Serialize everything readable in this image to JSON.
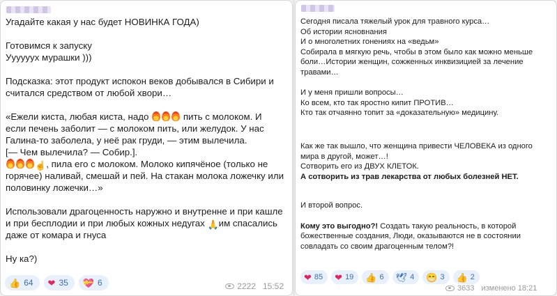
{
  "left": {
    "lines": {
      "l1": "Угадайте какая у нас будет НОВИНКА ГОДА)",
      "l2": "Готовимся к запуску",
      "l3": "Уууууух мурашки )))",
      "l4": "Подсказка: этот продукт испокон веков добывался в Сибири и",
      "l5": "считался средством от любой хвори…",
      "l6a": "«Ежели киста, любая киста, надо ",
      "l6b": " пить с молоком. И",
      "l7": "если печень заболит — с молоком пить, или желудок. У нас",
      "l8": "Галина-то заболела, у неё рак груди, — этим вылечила.",
      "l9": "[— Чем вылечила? — Собир.].",
      "l10": ", пила его с молоком. Молоко кипячёное (только не",
      "l11": "горячее) наливай, смешай и пей. На стакан молока ложечку или",
      "l12": "половинку ложечки…»",
      "l13": "Использовали драгоценность наружно и внутренне и при кашле",
      "l14a": "и при бесплодии и при любых кожных недугах ",
      "l14b": "им спасались",
      "l15": "даже от комара и гнуса",
      "l16": "Ну ка?)"
    },
    "reactions": [
      {
        "icon": "thumbs-up-icon",
        "glyph": "👍",
        "count": "64"
      },
      {
        "icon": "heart-icon",
        "glyph": "❤",
        "count": "35"
      },
      {
        "icon": "heart-hands-icon",
        "glyph": "💝",
        "count": "6"
      }
    ],
    "views": "2222",
    "time": "15:52"
  },
  "right": {
    "lines": {
      "r1": "Сегодня писала тяжелый урок для травного курса…",
      "r2": "Об истории ясновнания",
      "r3": "И о многолетних гонениях на «ведьм»",
      "r4": "Собирала в мягкую речь, чтобы в этом было как можно меньше",
      "r5": "боли…Истории женщин, сожженных инквизицией за лечение",
      "r6": "травами…",
      "r7": "И у меня пришли вопросы…",
      "r8": "Ко всем, кто так яростно кипит ПРОТИВ…",
      "r9": "Кто так отчаянно топит за «доказательную» медицину.",
      "r10": "Как же так вышло, что женщина привести ЧЕЛОВЕКА из одного",
      "r11": "мира в другой, может…!",
      "r12": "Сотворить его из ДВУХ КЛЕТОК.",
      "r13": "А сотворить из трав лекарства от любых болезней НЕТ.",
      "r14": "И второй вопрос.",
      "r15a": "Кому это выгодно?!",
      "r15b": " Создать такую реальность, в которой",
      "r16": "божественные создания, Люди, оказываются не в состоянии",
      "r17": "совладать со своим драгоценным телом?!"
    },
    "reactions": [
      {
        "icon": "heart-icon",
        "glyph": "❤",
        "count": "85"
      },
      {
        "icon": "heart-icon",
        "glyph": "❤",
        "count": "19"
      },
      {
        "icon": "thumbs-up-icon",
        "glyph": "👍",
        "count": "6"
      },
      {
        "icon": "dove-icon",
        "glyph": "🕊",
        "count": "4"
      },
      {
        "icon": "grin-icon",
        "glyph": "😁",
        "count": "3"
      },
      {
        "icon": "thumbs-up-icon",
        "glyph": "👍",
        "count": "2"
      }
    ],
    "views": "3633",
    "edited": "изменено 18:21"
  },
  "colors": {
    "accent": "#3b6fb6",
    "reaction_bg": "#e8f0fb",
    "heart": "#e0245e"
  }
}
